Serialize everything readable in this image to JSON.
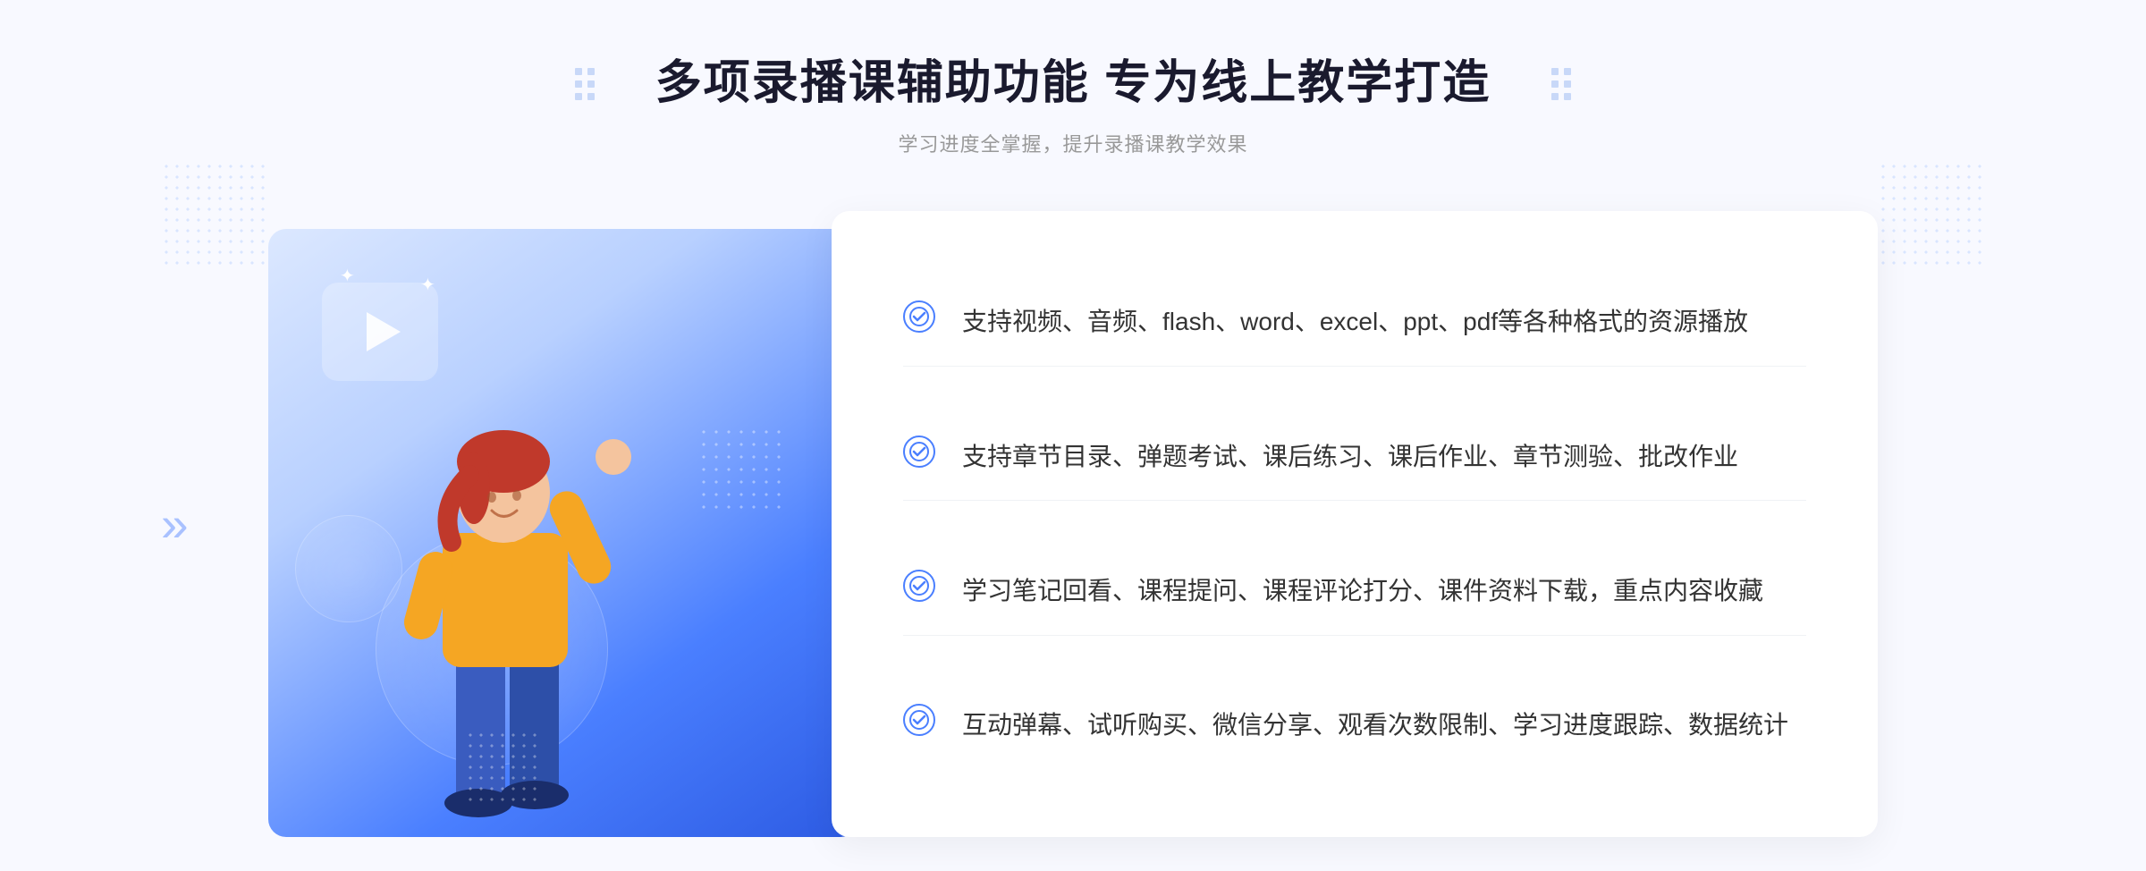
{
  "header": {
    "main_title": "多项录播课辅助功能 专为线上教学打造",
    "sub_title": "学习进度全掌握，提升录播课教学效果"
  },
  "features": [
    {
      "id": "feature-1",
      "text": "支持视频、音频、flash、word、excel、ppt、pdf等各种格式的资源播放"
    },
    {
      "id": "feature-2",
      "text": "支持章节目录、弹题考试、课后练习、课后作业、章节测验、批改作业"
    },
    {
      "id": "feature-3",
      "text": "学习笔记回看、课程提问、课程评论打分、课件资料下载，重点内容收藏"
    },
    {
      "id": "feature-4",
      "text": "互动弹幕、试听购买、微信分享、观看次数限制、学习进度跟踪、数据统计"
    }
  ],
  "decorations": {
    "chevron_left": "»",
    "check_mark": "✓"
  },
  "colors": {
    "primary_blue": "#4a7fff",
    "dark_blue": "#2d5be3",
    "light_blue": "#b8d0ff",
    "text_dark": "#1a1a2e",
    "text_gray": "#999999",
    "text_content": "#333333"
  }
}
